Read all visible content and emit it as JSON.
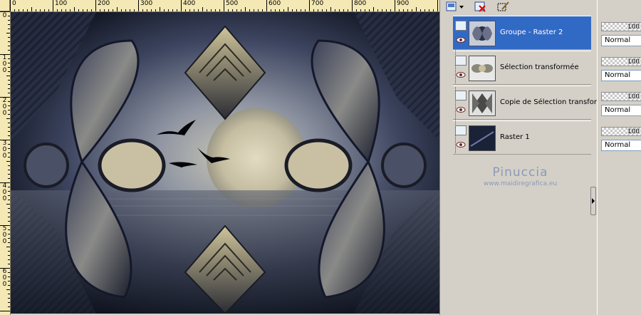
{
  "ruler": {
    "top_labels": [
      "0",
      "100",
      "200",
      "300",
      "400",
      "500",
      "600",
      "700",
      "800",
      "900"
    ],
    "left_labels": [
      "0",
      "1\n0\n0",
      "2\n0\n0",
      "3\n0\n0",
      "4\n0\n0",
      "5\n0\n0",
      "6\n0\n0"
    ]
  },
  "layers": {
    "items": [
      {
        "name": "Groupe - Raster 2",
        "selected": true,
        "icon": "group-layer-icon"
      },
      {
        "name": "Sélection transformée",
        "selected": false,
        "icon": "raster-layer-icon"
      },
      {
        "name": "Copie de Sélection transformée",
        "selected": false,
        "icon": "raster-layer-icon"
      },
      {
        "name": "Raster 1",
        "selected": false,
        "icon": "raster-layer-icon"
      }
    ]
  },
  "watermark": {
    "title": "Pinuccia",
    "url": "www.maidiregrafica.eu"
  },
  "properties": {
    "rows": [
      {
        "opacity": "100",
        "blend": "Normal"
      },
      {
        "opacity": "100",
        "blend": "Normal"
      },
      {
        "opacity": "100",
        "blend": "Normal"
      },
      {
        "opacity": "100",
        "blend": "Normal"
      }
    ]
  },
  "colors": {
    "selection": "#316ac5",
    "ruler": "#f4e8b4",
    "panel": "#d4d0c8",
    "watermark": "#8a9bb5"
  }
}
